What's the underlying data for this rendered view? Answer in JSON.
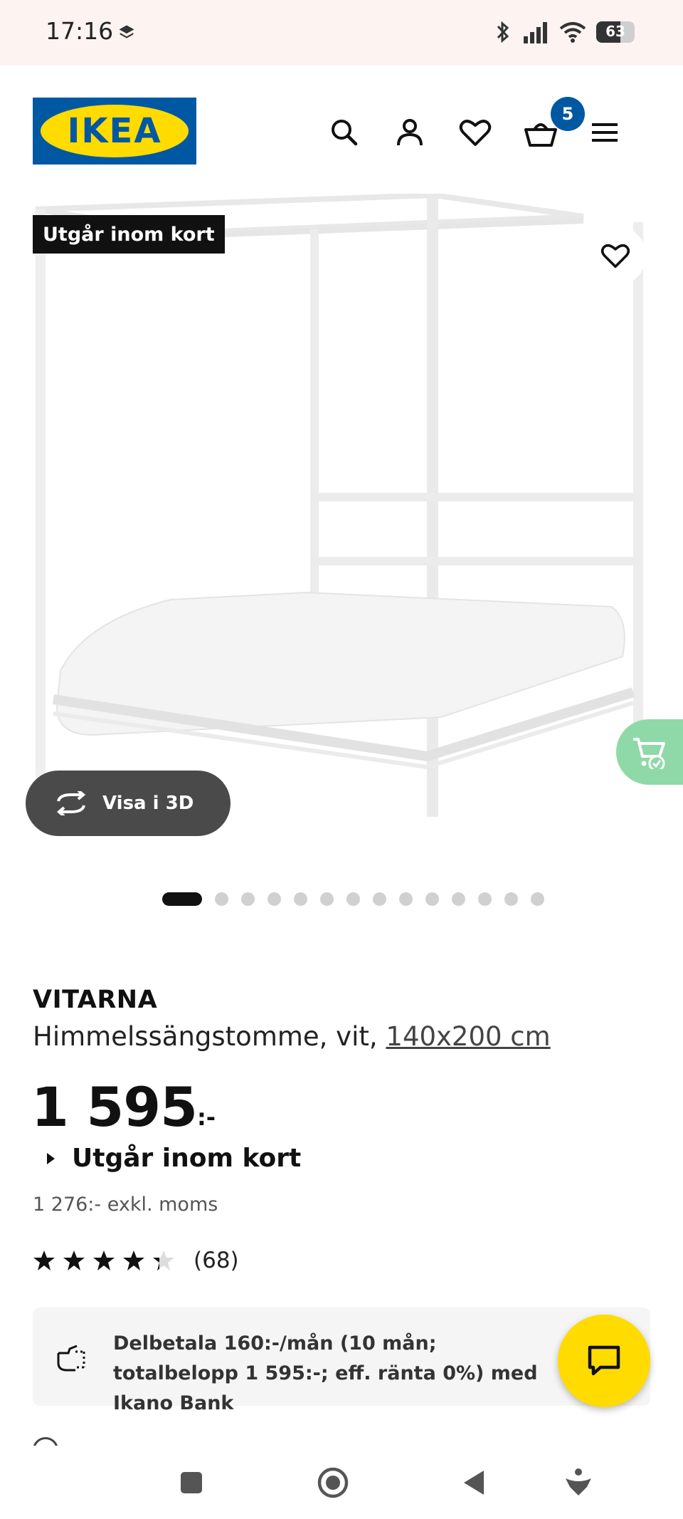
{
  "status_bar": {
    "time": "17:16",
    "battery": "63"
  },
  "header": {
    "logo_text": "IKEA",
    "cart_count": "5",
    "brand_blue": "#0058a3",
    "brand_yellow": "#ffdb00"
  },
  "product_image": {
    "badge": "Utgår inom kort",
    "view_3d_label": "Visa i 3D",
    "image_count": 14,
    "active_index": 0
  },
  "product": {
    "name": "VITARNA",
    "description": "Himmelssängstomme, vit,",
    "size": "140x200 cm",
    "price": "1 595",
    "price_suffix": ":-",
    "availability": "Utgår inom kort",
    "excl_vat": "1 276:- exkl. moms",
    "rating_value": 4.3,
    "rating_max": 5,
    "rating_count": "(68)"
  },
  "payment": {
    "text": "Delbetala 160:-/mån (10 mån; totalbelopp 1 595:-; eff. ränta 0%) med Ikano Bank"
  }
}
